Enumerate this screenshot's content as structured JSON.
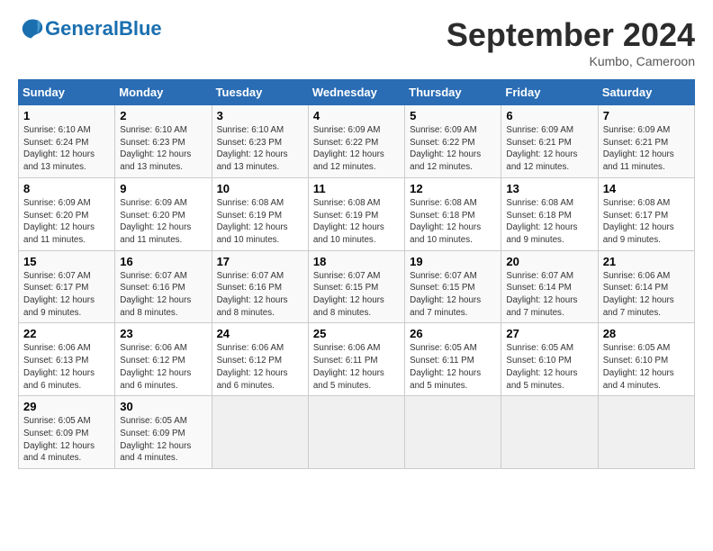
{
  "header": {
    "logo_text_general": "General",
    "logo_text_blue": "Blue",
    "month_title": "September 2024",
    "location": "Kumbo, Cameroon"
  },
  "table": {
    "headers": [
      "Sunday",
      "Monday",
      "Tuesday",
      "Wednesday",
      "Thursday",
      "Friday",
      "Saturday"
    ],
    "rows": [
      [
        {
          "day": "1",
          "info": "Sunrise: 6:10 AM\nSunset: 6:24 PM\nDaylight: 12 hours\nand 13 minutes."
        },
        {
          "day": "2",
          "info": "Sunrise: 6:10 AM\nSunset: 6:23 PM\nDaylight: 12 hours\nand 13 minutes."
        },
        {
          "day": "3",
          "info": "Sunrise: 6:10 AM\nSunset: 6:23 PM\nDaylight: 12 hours\nand 13 minutes."
        },
        {
          "day": "4",
          "info": "Sunrise: 6:09 AM\nSunset: 6:22 PM\nDaylight: 12 hours\nand 12 minutes."
        },
        {
          "day": "5",
          "info": "Sunrise: 6:09 AM\nSunset: 6:22 PM\nDaylight: 12 hours\nand 12 minutes."
        },
        {
          "day": "6",
          "info": "Sunrise: 6:09 AM\nSunset: 6:21 PM\nDaylight: 12 hours\nand 12 minutes."
        },
        {
          "day": "7",
          "info": "Sunrise: 6:09 AM\nSunset: 6:21 PM\nDaylight: 12 hours\nand 11 minutes."
        }
      ],
      [
        {
          "day": "8",
          "info": "Sunrise: 6:09 AM\nSunset: 6:20 PM\nDaylight: 12 hours\nand 11 minutes."
        },
        {
          "day": "9",
          "info": "Sunrise: 6:09 AM\nSunset: 6:20 PM\nDaylight: 12 hours\nand 11 minutes."
        },
        {
          "day": "10",
          "info": "Sunrise: 6:08 AM\nSunset: 6:19 PM\nDaylight: 12 hours\nand 10 minutes."
        },
        {
          "day": "11",
          "info": "Sunrise: 6:08 AM\nSunset: 6:19 PM\nDaylight: 12 hours\nand 10 minutes."
        },
        {
          "day": "12",
          "info": "Sunrise: 6:08 AM\nSunset: 6:18 PM\nDaylight: 12 hours\nand 10 minutes."
        },
        {
          "day": "13",
          "info": "Sunrise: 6:08 AM\nSunset: 6:18 PM\nDaylight: 12 hours\nand 9 minutes."
        },
        {
          "day": "14",
          "info": "Sunrise: 6:08 AM\nSunset: 6:17 PM\nDaylight: 12 hours\nand 9 minutes."
        }
      ],
      [
        {
          "day": "15",
          "info": "Sunrise: 6:07 AM\nSunset: 6:17 PM\nDaylight: 12 hours\nand 9 minutes."
        },
        {
          "day": "16",
          "info": "Sunrise: 6:07 AM\nSunset: 6:16 PM\nDaylight: 12 hours\nand 8 minutes."
        },
        {
          "day": "17",
          "info": "Sunrise: 6:07 AM\nSunset: 6:16 PM\nDaylight: 12 hours\nand 8 minutes."
        },
        {
          "day": "18",
          "info": "Sunrise: 6:07 AM\nSunset: 6:15 PM\nDaylight: 12 hours\nand 8 minutes."
        },
        {
          "day": "19",
          "info": "Sunrise: 6:07 AM\nSunset: 6:15 PM\nDaylight: 12 hours\nand 7 minutes."
        },
        {
          "day": "20",
          "info": "Sunrise: 6:07 AM\nSunset: 6:14 PM\nDaylight: 12 hours\nand 7 minutes."
        },
        {
          "day": "21",
          "info": "Sunrise: 6:06 AM\nSunset: 6:14 PM\nDaylight: 12 hours\nand 7 minutes."
        }
      ],
      [
        {
          "day": "22",
          "info": "Sunrise: 6:06 AM\nSunset: 6:13 PM\nDaylight: 12 hours\nand 6 minutes."
        },
        {
          "day": "23",
          "info": "Sunrise: 6:06 AM\nSunset: 6:12 PM\nDaylight: 12 hours\nand 6 minutes."
        },
        {
          "day": "24",
          "info": "Sunrise: 6:06 AM\nSunset: 6:12 PM\nDaylight: 12 hours\nand 6 minutes."
        },
        {
          "day": "25",
          "info": "Sunrise: 6:06 AM\nSunset: 6:11 PM\nDaylight: 12 hours\nand 5 minutes."
        },
        {
          "day": "26",
          "info": "Sunrise: 6:05 AM\nSunset: 6:11 PM\nDaylight: 12 hours\nand 5 minutes."
        },
        {
          "day": "27",
          "info": "Sunrise: 6:05 AM\nSunset: 6:10 PM\nDaylight: 12 hours\nand 5 minutes."
        },
        {
          "day": "28",
          "info": "Sunrise: 6:05 AM\nSunset: 6:10 PM\nDaylight: 12 hours\nand 4 minutes."
        }
      ],
      [
        {
          "day": "29",
          "info": "Sunrise: 6:05 AM\nSunset: 6:09 PM\nDaylight: 12 hours\nand 4 minutes."
        },
        {
          "day": "30",
          "info": "Sunrise: 6:05 AM\nSunset: 6:09 PM\nDaylight: 12 hours\nand 4 minutes."
        },
        {
          "day": "",
          "info": ""
        },
        {
          "day": "",
          "info": ""
        },
        {
          "day": "",
          "info": ""
        },
        {
          "day": "",
          "info": ""
        },
        {
          "day": "",
          "info": ""
        }
      ]
    ]
  }
}
